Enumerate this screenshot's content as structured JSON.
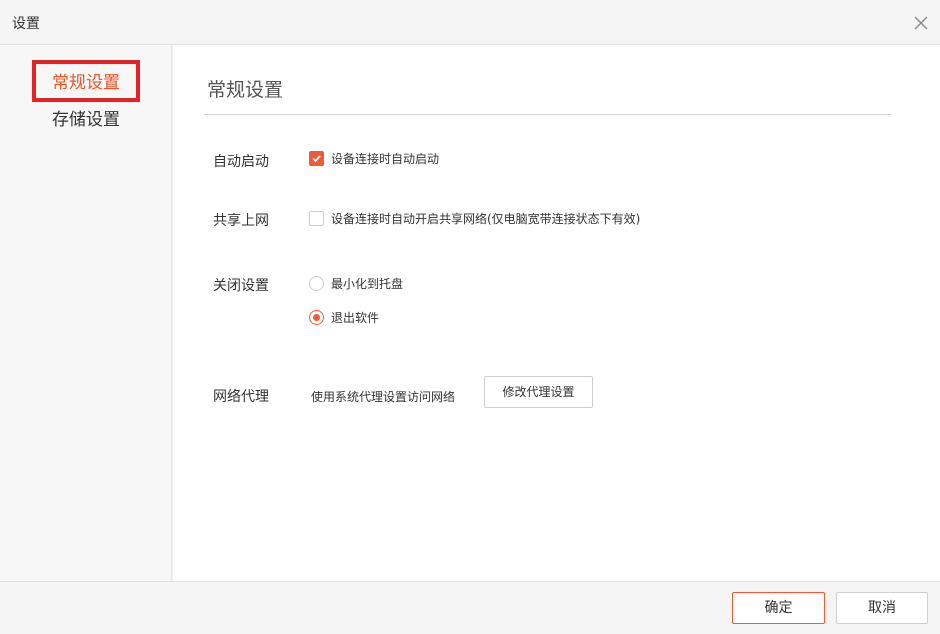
{
  "window": {
    "title": "设置",
    "close_icon": "close-icon"
  },
  "sidebar": {
    "items": [
      {
        "label": "常规设置",
        "active": true
      },
      {
        "label": "存储设置",
        "active": false
      }
    ]
  },
  "main": {
    "heading": "常规设置",
    "auto_start": {
      "label": "自动启动",
      "option_text": "设备连接时自动启动",
      "checked": true
    },
    "share_network": {
      "label": "共享上网",
      "option_text": "设备连接时自动开启共享网络(仅电脑宽带连接状态下有效)",
      "checked": false
    },
    "close_settings": {
      "label": "关闭设置",
      "options": [
        {
          "text": "最小化到托盘",
          "selected": false
        },
        {
          "text": "退出软件",
          "selected": true
        }
      ]
    },
    "proxy": {
      "label": "网络代理",
      "description": "使用系统代理设置访问网络",
      "button_label": "修改代理设置"
    }
  },
  "footer": {
    "ok_label": "确定",
    "cancel_label": "取消"
  },
  "colors": {
    "accent": "#ef5a37",
    "highlight_border": "#e32424"
  }
}
